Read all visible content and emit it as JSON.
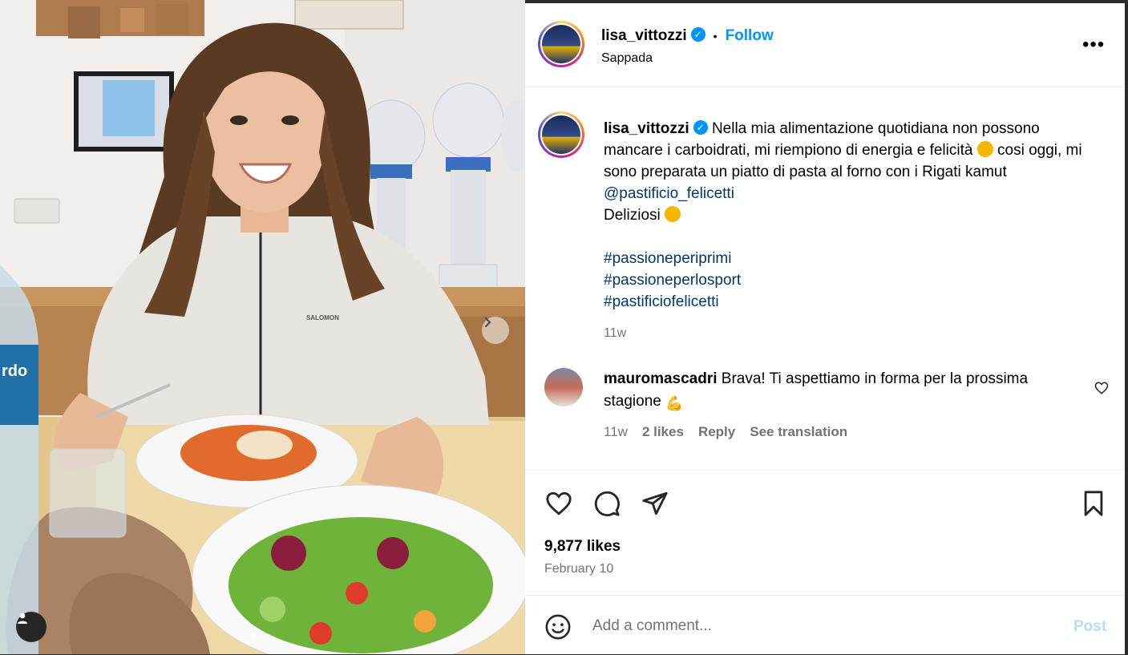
{
  "post": {
    "username": "lisa_vittozzi",
    "follow_label": "Follow",
    "location": "Sappada",
    "more_icon": "more-horizontal-icon",
    "caption": {
      "line1": "Nella mia alimentazione quotidiana non possono mancare i carboidrati, mi riempiono di energia e felicità",
      "line2": "cosi oggi, mi sono preparata un piatto di pasta al forno con i Rigati kamut",
      "mention": "@pastificio_felicetti",
      "line3": "Deliziosi",
      "hashtags": [
        "#passioneperiprimi",
        "#passioneperlosport",
        "#pastificiofelicetti"
      ],
      "time": "11w"
    },
    "comments": [
      {
        "username": "mauromascadri",
        "text": "Brava! Ti aspettiamo in forma per la prossima stagione",
        "time": "11w",
        "likes": "2 likes",
        "reply": "Reply",
        "translate": "See translation"
      }
    ],
    "likes": "9,877 likes",
    "date": "February 10",
    "comment_placeholder": "Add a comment...",
    "post_label": "Post"
  },
  "photo": {
    "bottle_text": "rdo",
    "jacket_text": "SALOMON",
    "carousel_dots": 2,
    "carousel_active": 0
  },
  "colors": {
    "accent": "#0095f6",
    "link": "#00376b",
    "muted": "#737373",
    "post_disabled": "#b2dffc"
  }
}
